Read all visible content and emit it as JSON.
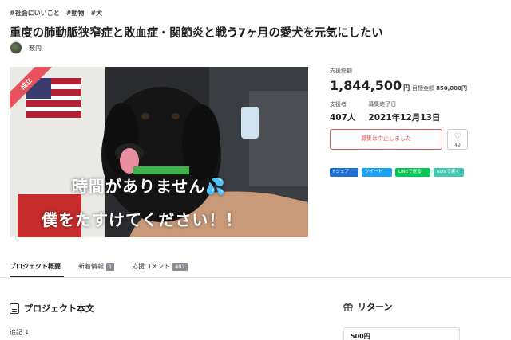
{
  "tags": [
    "#社会にいいこと",
    "#動物",
    "#犬"
  ],
  "title": "重度の肺動脈狭窄症と敗血症・関節炎と戦う7ヶ月の愛犬を元気にしたい",
  "owner": {
    "name": "薮内"
  },
  "hero": {
    "banner": "成立",
    "line1": "時間がありません💦",
    "line2": "僕をたすけてください！！"
  },
  "funding": {
    "label": "支援総額",
    "amount": "1,844,500",
    "unit": "円",
    "goal_label": "目標金額",
    "goal_value": "850,000円"
  },
  "stats": {
    "backers_label": "支援者",
    "backers_value": "407人",
    "end_label": "募集終了日",
    "end_value": "2021年12月13日"
  },
  "actions": {
    "stopped_label": "募集は中止しました",
    "like_icon": "heart-icon",
    "like_count": "49"
  },
  "share": {
    "facebook": "f シェア",
    "twitter": "ツイート",
    "line": "LINEで送る",
    "note": "noteで書く"
  },
  "tabs": [
    {
      "label": "プロジェクト概要",
      "badge": ""
    },
    {
      "label": "新着情報",
      "badge": "1"
    },
    {
      "label": "応援コメント",
      "badge": "407"
    }
  ],
  "section": {
    "title": "プロジェクト本文",
    "note": "追記 ↓"
  },
  "returns": {
    "title": "リターン",
    "first_price": "500円"
  },
  "colors": {
    "accent": "#d9585e",
    "facebook": "#1d6fd6",
    "twitter": "#1da1f2",
    "line": "#06c755",
    "note": "#41c9b4"
  }
}
